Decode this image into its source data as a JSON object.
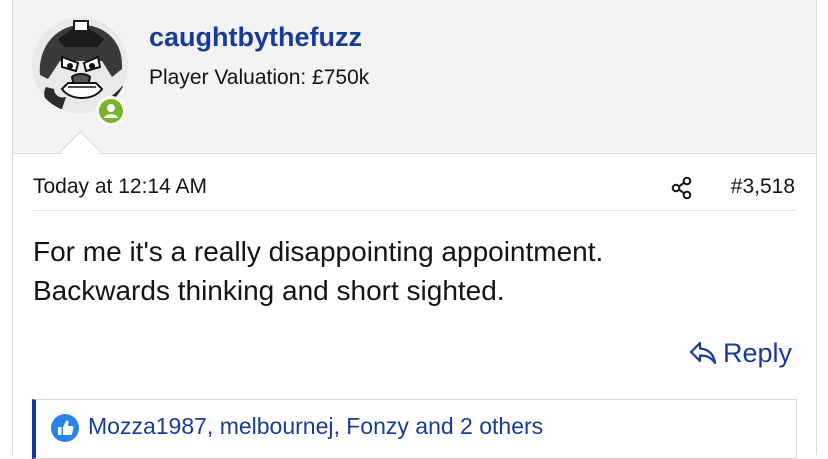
{
  "user": {
    "username": "caughtbythefuzz",
    "valuation": "Player Valuation: £750k",
    "avatar": "avatar-icon",
    "online_status": "online-indicator-icon",
    "online_color": "#7ab32e"
  },
  "post": {
    "date": "Today at 12:14 AM",
    "number": "#3,518",
    "share_icon": "share-icon",
    "body_lines": [
      "For me it's a really disappointing appointment.",
      "Backwards thinking and short sighted."
    ],
    "reply_label": "Reply",
    "reply_icon": "reply-arrow-icon"
  },
  "reactions": {
    "icon": "thumbs-up-icon",
    "text": "Mozza1987, melbournej, Fonzy and 2 others"
  },
  "colors": {
    "link": "#183c96",
    "like": "#2a83e6",
    "header_bg": "#f3f3f3"
  }
}
